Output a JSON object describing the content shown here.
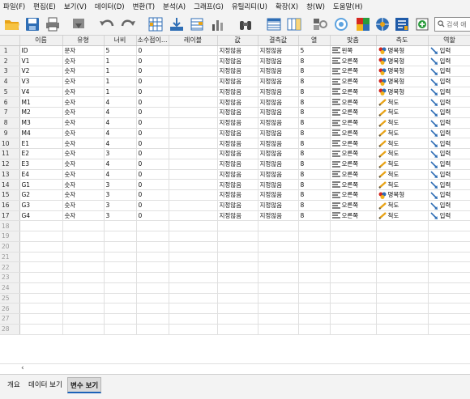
{
  "menu": [
    "파일(F)",
    "편집(E)",
    "보기(V)",
    "데이터(D)",
    "변환(T)",
    "분석(A)",
    "그래프(G)",
    "유틸리티(U)",
    "확장(X)",
    "창(W)",
    "도움말(H)"
  ],
  "search": {
    "placeholder": "검색 애"
  },
  "columns": [
    "이름",
    "유형",
    "너비",
    "소수점이...",
    "레이블",
    "값",
    "결측값",
    "열",
    "맞춤",
    "측도",
    "역할"
  ],
  "rows": [
    [
      "ID",
      "문자",
      "5",
      "0",
      "",
      "지정않음",
      "지정않음",
      "5",
      "왼쪽",
      "명목형",
      "입력"
    ],
    [
      "V1",
      "숫자",
      "1",
      "0",
      "",
      "지정않음",
      "지정않음",
      "8",
      "오른쪽",
      "명목형",
      "입력"
    ],
    [
      "V2",
      "숫자",
      "1",
      "0",
      "",
      "지정않음",
      "지정않음",
      "8",
      "오른쪽",
      "명목형",
      "입력"
    ],
    [
      "V3",
      "숫자",
      "1",
      "0",
      "",
      "지정않음",
      "지정않음",
      "8",
      "오른쪽",
      "명목형",
      "입력"
    ],
    [
      "V4",
      "숫자",
      "1",
      "0",
      "",
      "지정않음",
      "지정않음",
      "8",
      "오른쪽",
      "명목형",
      "입력"
    ],
    [
      "M1",
      "숫자",
      "4",
      "0",
      "",
      "지정않음",
      "지정않음",
      "8",
      "오른쪽",
      "척도",
      "입력"
    ],
    [
      "M2",
      "숫자",
      "4",
      "0",
      "",
      "지정않음",
      "지정않음",
      "8",
      "오른쪽",
      "척도",
      "입력"
    ],
    [
      "M3",
      "숫자",
      "4",
      "0",
      "",
      "지정않음",
      "지정않음",
      "8",
      "오른쪽",
      "척도",
      "입력"
    ],
    [
      "M4",
      "숫자",
      "4",
      "0",
      "",
      "지정않음",
      "지정않음",
      "8",
      "오른쪽",
      "척도",
      "입력"
    ],
    [
      "E1",
      "숫자",
      "4",
      "0",
      "",
      "지정않음",
      "지정않음",
      "8",
      "오른쪽",
      "척도",
      "입력"
    ],
    [
      "E2",
      "숫자",
      "3",
      "0",
      "",
      "지정않음",
      "지정않음",
      "8",
      "오른쪽",
      "척도",
      "입력"
    ],
    [
      "E3",
      "숫자",
      "4",
      "0",
      "",
      "지정않음",
      "지정않음",
      "8",
      "오른쪽",
      "척도",
      "입력"
    ],
    [
      "E4",
      "숫자",
      "4",
      "0",
      "",
      "지정않음",
      "지정않음",
      "8",
      "오른쪽",
      "척도",
      "입력"
    ],
    [
      "G1",
      "숫자",
      "3",
      "0",
      "",
      "지정않음",
      "지정않음",
      "8",
      "오른쪽",
      "척도",
      "입력"
    ],
    [
      "G2",
      "숫자",
      "3",
      "0",
      "",
      "지정않음",
      "지정않음",
      "8",
      "오른쪽",
      "명목형",
      "입력"
    ],
    [
      "G3",
      "숫자",
      "3",
      "0",
      "",
      "지정않음",
      "지정않음",
      "8",
      "오른쪽",
      "척도",
      "입력"
    ],
    [
      "G4",
      "숫자",
      "3",
      "0",
      "",
      "지정않음",
      "지정않음",
      "8",
      "오른쪽",
      "척도",
      "입력"
    ]
  ],
  "empty_row_numbers": [
    "18",
    "19",
    "20",
    "21",
    "22",
    "23",
    "24",
    "25",
    "26",
    "27",
    "28"
  ],
  "tabs": [
    "개요",
    "데이터 보기",
    "변수 보기"
  ],
  "active_tab": "변수 보기",
  "colors": {
    "accent": "#1a62b8",
    "header_bg": "#f0f0f0",
    "grid_line": "#e0e0e0"
  },
  "toolbar_icons": [
    "open-folder-icon",
    "save-icon",
    "print-icon",
    "recall-dialog-icon",
    "undo-icon",
    "redo-icon",
    "go-to-case-icon",
    "go-to-variable-icon",
    "variables-icon",
    "run-descriptives-icon",
    "find-icon",
    "insert-cases-icon",
    "insert-variable-icon",
    "split-file-icon",
    "weight-cases-icon",
    "select-cases-icon",
    "value-labels-icon",
    "use-variable-sets-icon",
    "show-all-variables-icon",
    "spell-check-icon"
  ]
}
